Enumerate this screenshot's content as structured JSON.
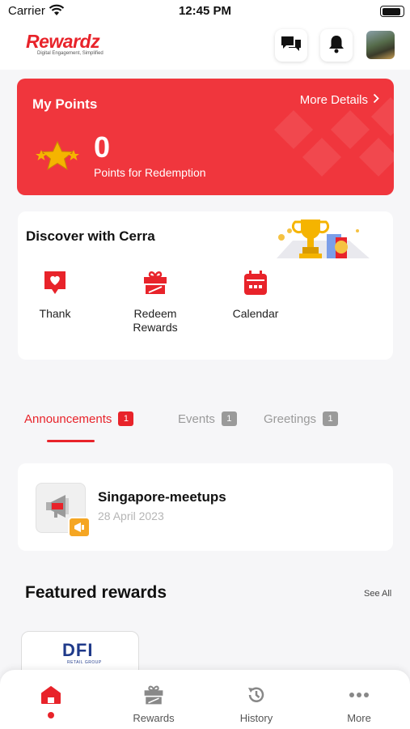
{
  "status_bar": {
    "carrier": "Carrier",
    "time": "12:45 PM",
    "battery_level": 0.9
  },
  "header": {
    "logo": "Rewardz",
    "tagline": "Digital Engagement, Simplified",
    "icons": [
      "chat-icon",
      "bell-icon",
      "avatar"
    ]
  },
  "points": {
    "title": "My Points",
    "more": "More Details",
    "value": "0",
    "label": "Points for Redemption",
    "bg_color": "#f0363d"
  },
  "discover": {
    "title": "Discover with Cerra",
    "actions": [
      {
        "label": "Thank",
        "icon": "heart-message-icon"
      },
      {
        "label": "Redeem Rewards",
        "icon": "gift-icon"
      },
      {
        "label": "Calendar",
        "icon": "calendar-icon"
      }
    ]
  },
  "tabs": [
    {
      "label": "Announcements",
      "count": "1",
      "active": true
    },
    {
      "label": "Events",
      "count": "1",
      "active": false
    },
    {
      "label": "Greetings",
      "count": "1",
      "active": false
    }
  ],
  "announcement": {
    "title": "Singapore-meetups",
    "date": "28 April 2023",
    "icon": "megaphone-icon"
  },
  "featured": {
    "title": "Featured rewards",
    "see_all": "See All",
    "reward_brand": "DFI",
    "reward_sub": "RETAIL GROUP"
  },
  "nav": [
    {
      "label": "",
      "icon": "home-icon",
      "active": true
    },
    {
      "label": "Rewards",
      "icon": "gift-icon",
      "active": false
    },
    {
      "label": "History",
      "icon": "history-icon",
      "active": false
    },
    {
      "label": "More",
      "icon": "more-icon",
      "active": false
    }
  ],
  "colors": {
    "accent": "#e8232a",
    "inactive_badge": "#9a9a9a",
    "star": "#f5b400"
  }
}
